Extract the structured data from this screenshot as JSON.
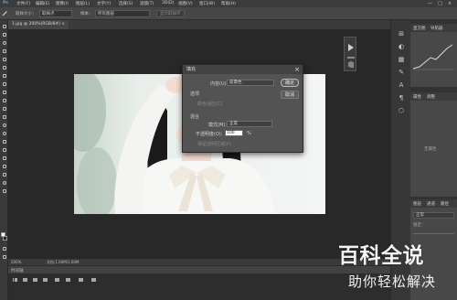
{
  "menubar": {
    "items": [
      "文件(F)",
      "编辑(E)",
      "图像(I)",
      "图层(L)",
      "文字(Y)",
      "选择(S)",
      "滤镜(T)",
      "3D(D)",
      "视图(V)",
      "窗口(W)",
      "帮助(H)"
    ],
    "window_controls": [
      "—",
      "□",
      "×"
    ]
  },
  "options_bar": {
    "size_label": "取样大小：",
    "size_value": "取样点",
    "sample_label": "样本：",
    "sample_value": "所有图层",
    "show_ring_label": "显示取样环"
  },
  "document_tab": {
    "title": "1.jpg @ 200%(RGB/8#) ×"
  },
  "status_bar": {
    "zoom": "200%",
    "doc_info": "文档:1.60M/1.60M"
  },
  "timeline": {
    "tab_label": "时间轴"
  },
  "right_panel": {
    "histogram_tab": "直方图",
    "navigator_tab": "导航器",
    "properties_tab": "属性",
    "adjust_tab": "调整",
    "layers_tab": "图层",
    "channels_tab": "通道",
    "paths_tab": "路径",
    "mode_value": "正常",
    "lock_label": "锁定：",
    "no_properties": "无属性"
  },
  "fill_dialog": {
    "title": "填充",
    "content_label": "内容(U):",
    "content_value": "前景色",
    "options_header": "选项",
    "color_adapt_label": "颜色适应(C)",
    "blending_header": "混合",
    "mode_label": "模式(M):",
    "mode_value": "正常",
    "opacity_label": "不透明度(O):",
    "opacity_value": "100",
    "opacity_unit": "%",
    "preserve_transparency_label": "保留透明区域(P)",
    "ok_label": "确定",
    "cancel_label": "取消"
  },
  "watermark": {
    "line1": "百科全说",
    "line2": "助你轻松解决"
  }
}
